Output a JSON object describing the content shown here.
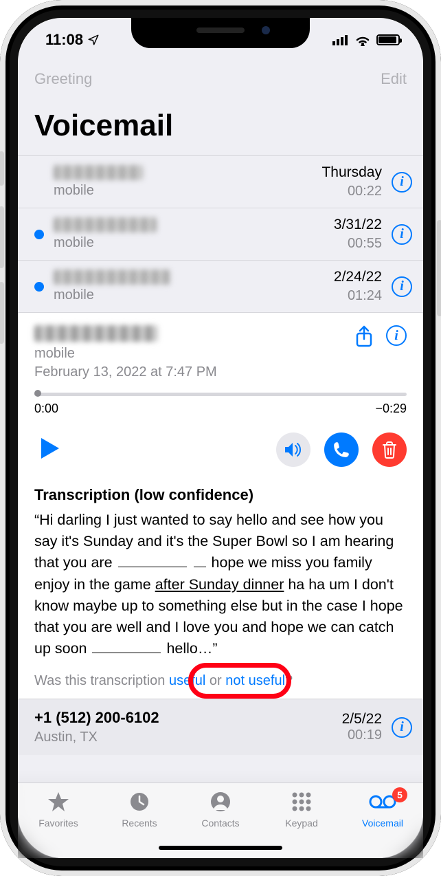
{
  "status": {
    "time": "11:08"
  },
  "nav": {
    "left": "Greeting",
    "right": "Edit"
  },
  "title": "Voicemail",
  "list": [
    {
      "unread": false,
      "name_w": 130,
      "sub": "mobile",
      "date": "Thursday",
      "dur": "00:22"
    },
    {
      "unread": true,
      "name_w": 150,
      "sub": "mobile",
      "date": "3/31/22",
      "dur": "00:55"
    },
    {
      "unread": true,
      "name_w": 170,
      "sub": "mobile",
      "date": "2/24/22",
      "dur": "01:24"
    }
  ],
  "expanded": {
    "sub": "mobile",
    "timestamp": "February 13, 2022 at 7:47 PM",
    "time_left": "0:00",
    "time_right": "−0:29",
    "trans_head": "Transcription (low confidence)",
    "trans_open": "“Hi darling I just wanted to say hello and see how you say it's Sunday and it's the Super Bowl so I am hearing that you are ",
    "trans_mid1": " hope we miss you family enjoy in the game ",
    "trans_ul": "after Sunday dinner",
    "trans_mid2": " ha ha um I don't know maybe up to something else but in the case I hope that you are well and I love you and hope we can catch up soon ",
    "trans_close": " hello…”",
    "feedback_pre": "Was this transcription ",
    "feedback_useful": "useful",
    "feedback_or": " or ",
    "feedback_notuseful": "not useful",
    "feedback_q": "?"
  },
  "below": {
    "phone": "+1 (512) 200-6102",
    "sub": "Austin, TX",
    "date": "2/5/22",
    "dur": "00:19"
  },
  "tabs": {
    "fav": "Favorites",
    "rec": "Recents",
    "con": "Contacts",
    "key": "Keypad",
    "vm": "Voicemail",
    "badge": "5"
  }
}
